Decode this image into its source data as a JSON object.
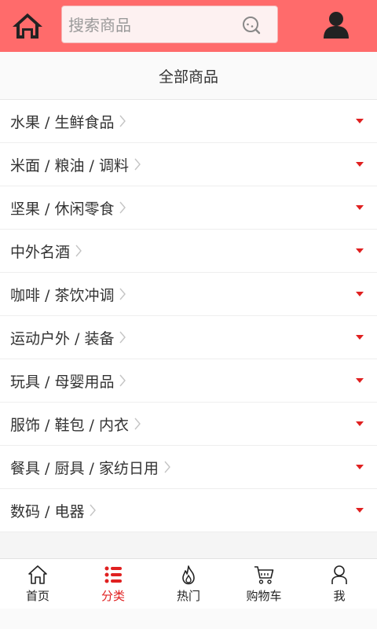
{
  "header": {
    "search_placeholder": "搜索商品",
    "background_color": "#ff6b6b",
    "home_icon": "home-icon",
    "search_icon": "search-icon",
    "user_icon": "user-icon"
  },
  "page_title": "全部商品",
  "categories": [
    {
      "label": "水果 / 生鲜食品"
    },
    {
      "label": "米面 / 粮油 / 调料"
    },
    {
      "label": "坚果 / 休闲零食"
    },
    {
      "label": "中外名酒"
    },
    {
      "label": "咖啡 / 茶饮冲调"
    },
    {
      "label": "运动户外 / 装备"
    },
    {
      "label": "玩具 / 母婴用品"
    },
    {
      "label": "服饰 / 鞋包 / 内衣"
    },
    {
      "label": "餐具 / 厨具 / 家纺日用"
    },
    {
      "label": "数码 / 电器"
    }
  ],
  "tabbar": {
    "active_color": "#e02020",
    "tabs": [
      {
        "label": "首页",
        "icon": "home-outline-icon"
      },
      {
        "label": "分类",
        "icon": "category-list-icon",
        "active": true
      },
      {
        "label": "热门",
        "icon": "flame-icon"
      },
      {
        "label": "购物车",
        "icon": "cart-icon"
      },
      {
        "label": "我",
        "icon": "person-outline-icon"
      }
    ]
  }
}
